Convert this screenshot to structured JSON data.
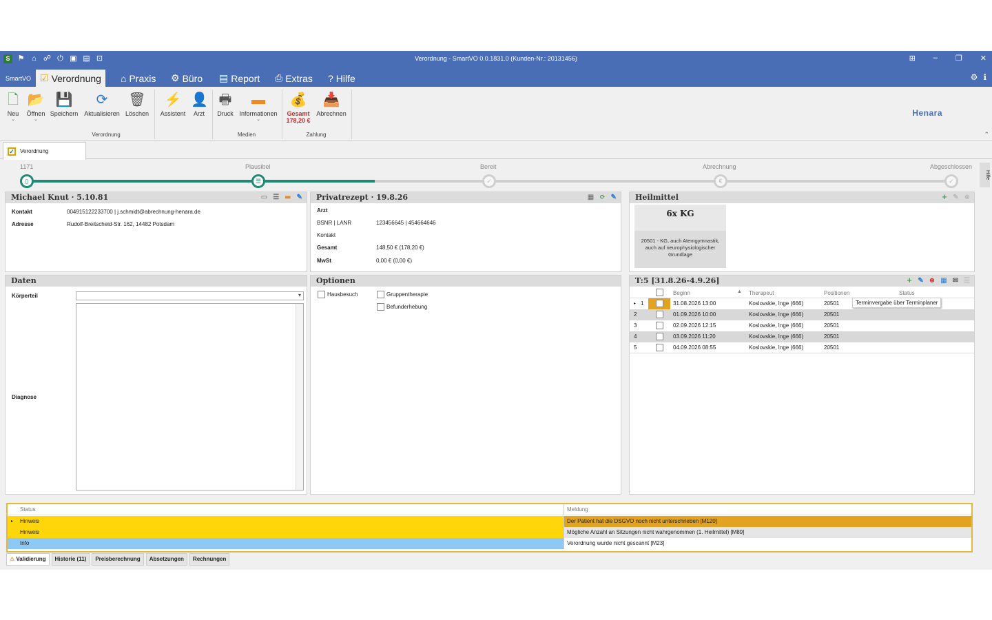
{
  "window": {
    "title": "Verordnung - SmartVO 0.0.1831.0 (Kunden-Nr.: 20131456)",
    "controls": [
      "⊞",
      "–",
      "❐",
      "✕"
    ]
  },
  "menu": {
    "app_label": "SmartVO",
    "tabs": [
      {
        "label": "Verordnung",
        "icon": "checklist-icon"
      },
      {
        "label": "Praxis",
        "icon": "home-icon"
      },
      {
        "label": "Büro",
        "icon": "gears-icon"
      },
      {
        "label": "Report",
        "icon": "clipboard-icon"
      },
      {
        "label": "Extras",
        "icon": "document-search-icon"
      },
      {
        "label": "Hilfe",
        "icon": "help-icon"
      }
    ]
  },
  "ribbon": {
    "buttons": [
      {
        "label": "Neu",
        "icon": "new-document-icon"
      },
      {
        "label": "Öffnen",
        "icon": "folder-icon"
      },
      {
        "label": "Speichern",
        "icon": "save-icon"
      },
      {
        "label": "Aktualisieren",
        "icon": "refresh-icon"
      },
      {
        "label": "Löschen",
        "icon": "trash-icon"
      },
      {
        "label": "Assistent",
        "icon": "lightning-icon"
      },
      {
        "label": "Arzt",
        "icon": "doctor-icon"
      },
      {
        "label": "Druck",
        "icon": "printer-icon"
      },
      {
        "label": "Informationen",
        "icon": "speech-bubble-icon"
      },
      {
        "label": "Gesamt",
        "icon": "money-icon"
      },
      {
        "label": "Abrechnen",
        "icon": "inbox-icon"
      }
    ],
    "gesamt_value": "178,20 €",
    "groups": {
      "verordnung": "Verordnung",
      "medien": "Medien",
      "zahlung": "Zahlung"
    },
    "logo": "Henara"
  },
  "doc_tab": {
    "label": "Verordnung"
  },
  "progress": {
    "steps": [
      {
        "label": "1171",
        "state": "done"
      },
      {
        "label": "Plausibel",
        "state": "current"
      },
      {
        "label": "Bereit",
        "state": "pending"
      },
      {
        "label": "Abrechnung",
        "state": "pending"
      },
      {
        "label": "Abgeschlossen",
        "state": "pending"
      }
    ],
    "side_label": "Hilfe"
  },
  "patient": {
    "title": "Michael Knut · 5.10.81",
    "kontakt_label": "Kontakt",
    "kontakt": "004915122233700 | j.schmidt@abrechnung-henara.de",
    "adresse_label": "Adresse",
    "adresse": "Rudolf-Breitscheid-Str. 162,  14482 Potsdam"
  },
  "rezept": {
    "title": "Privatrezept · 19.8.26",
    "arzt_label": "Arzt",
    "bsnr_label": "BSNR | LANR",
    "bsnr": "123456645 | 454664646",
    "kontakt_label": "Kontakt",
    "gesamt_label": "Gesamt",
    "gesamt": "148,50 € (178,20 €)",
    "mwst_label": "MwSt",
    "mwst": "0,00 € (0,00 €)"
  },
  "heilmittel": {
    "title": "Heilmittel",
    "tile_title": "6x KG",
    "tile_desc": "20501 - KG, auch Atemgymnastik, auch auf neurophysiologischer Grundlage"
  },
  "daten": {
    "title": "Daten",
    "koerperteil_label": "Körperteil",
    "koerperteil_value": "",
    "diagnose_label": "Diagnose",
    "diagnose_value": ""
  },
  "optionen": {
    "title": "Optionen",
    "hausbesuch": "Hausbesuch",
    "gruppentherapie": "Gruppentherapie",
    "befunderhebung": "Befunderhebung"
  },
  "termine": {
    "title": "T:5 [31.8.26-4.9.26]",
    "columns": [
      "Beginn",
      "Therapeut",
      "Positionen",
      "Status"
    ],
    "rows": [
      {
        "nr": "1",
        "beginn": "31.08.2026 13:00",
        "therapeut": "Koslovskie, Inge (666)",
        "positionen": "20501",
        "status": "Terminvergabe über Terminplaner"
      },
      {
        "nr": "2",
        "beginn": "01.09.2026 10:00",
        "therapeut": "Koslovskie, Inge (666)",
        "positionen": "20501",
        "status": ""
      },
      {
        "nr": "3",
        "beginn": "02.09.2026 12:15",
        "therapeut": "Koslovskie, Inge (666)",
        "positionen": "20501",
        "status": ""
      },
      {
        "nr": "4",
        "beginn": "03.09.2026 11:20",
        "therapeut": "Koslovskie, Inge (666)",
        "positionen": "20501",
        "status": ""
      },
      {
        "nr": "5",
        "beginn": "04.09.2026 08:55",
        "therapeut": "Koslovskie, Inge (666)",
        "positionen": "20501",
        "status": ""
      }
    ]
  },
  "validierung": {
    "columns": [
      "Status",
      "Meldung"
    ],
    "rows": [
      {
        "status": "Hinweis",
        "meldung": "Der Patient hat die DSGVO noch nicht unterschrieben [M120]",
        "status_color": "#ffd60a",
        "msg_color": "#e2a321"
      },
      {
        "status": "Hinweis",
        "meldung": "Mögliche Anzahl an Sitzungen nicht wahrgenommen (1. Heilmittel) [M89]",
        "status_color": "#ffd60a",
        "msg_color": "#e6e6e6"
      },
      {
        "status": "Info",
        "meldung": "Verordnung wurde nicht gescannt [M23]",
        "status_color": "#8ec9f5",
        "msg_color": "#ffffff"
      }
    ]
  },
  "bottom_tabs": [
    "Validierung",
    "Historie (11)",
    "Preisberechnung",
    "Absetzungen",
    "Rechnungen"
  ]
}
